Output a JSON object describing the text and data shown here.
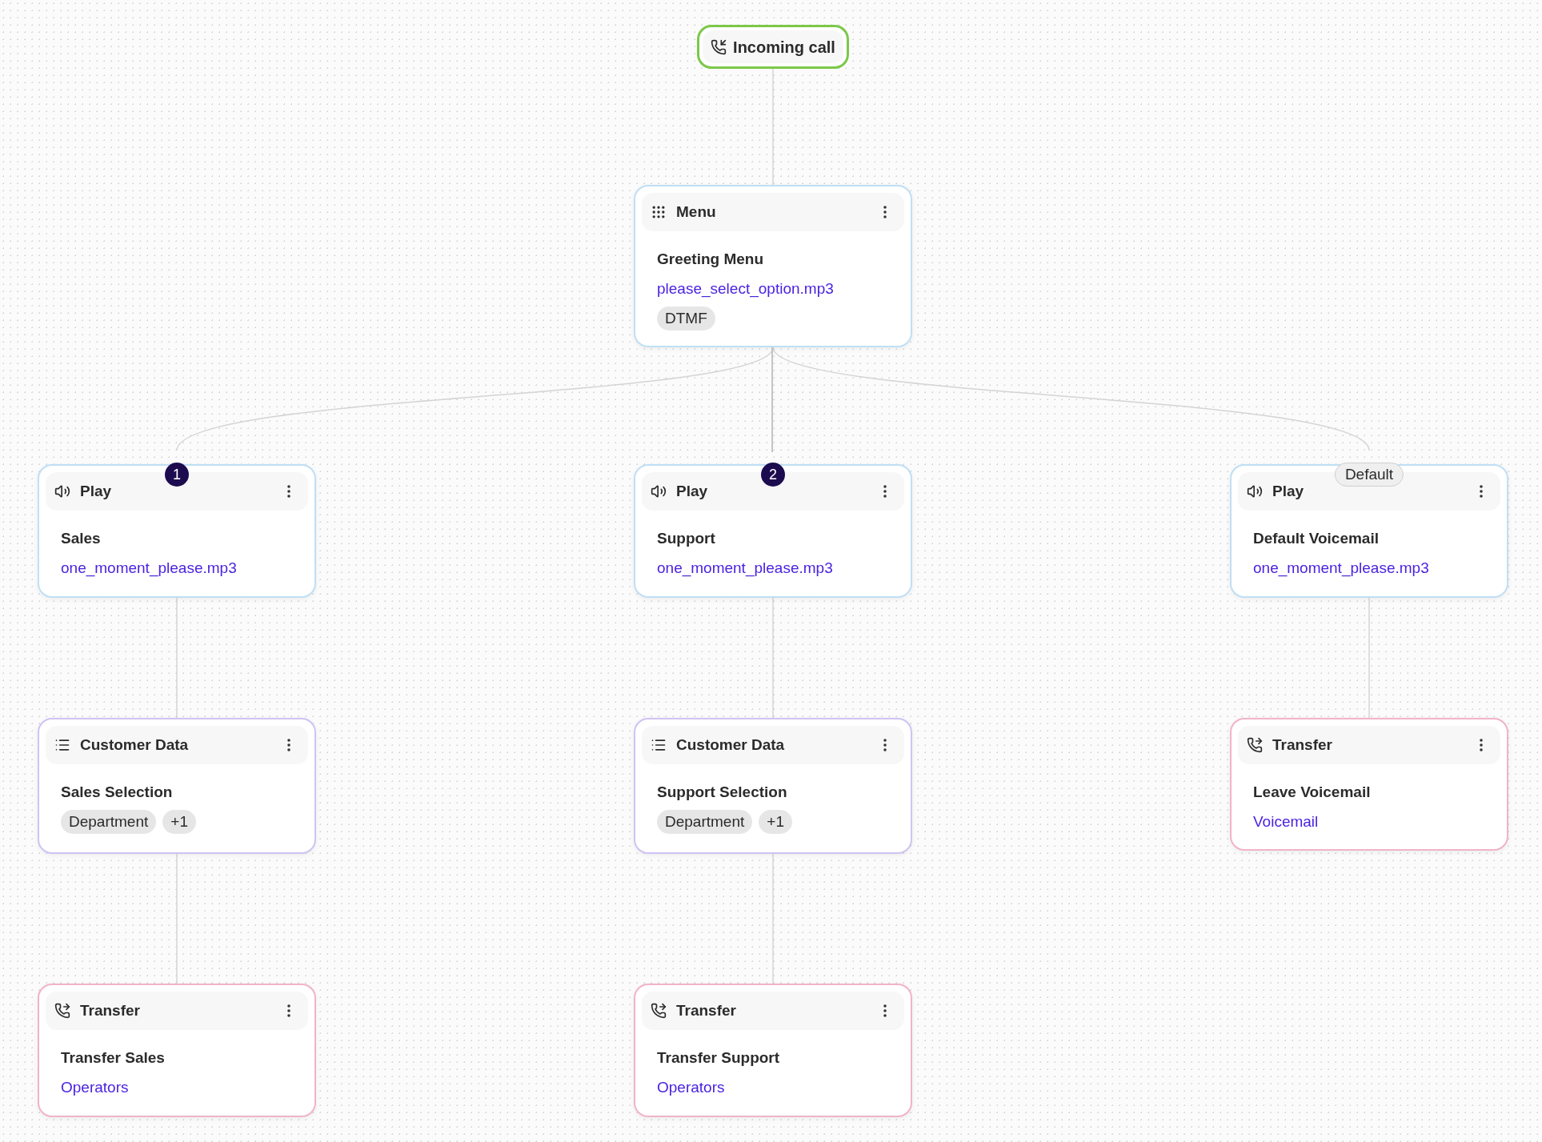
{
  "start": {
    "label": "Incoming call"
  },
  "nodes": [
    {
      "kind": "menu",
      "type_label": "Menu",
      "title": "Greeting Menu",
      "link": "please_select_option.mp3",
      "tags": [
        "DTMF"
      ]
    },
    {
      "kind": "play",
      "type_label": "Play",
      "branch": {
        "kind": "number",
        "text": "1"
      },
      "title": "Sales",
      "link": "one_moment_please.mp3"
    },
    {
      "kind": "play",
      "type_label": "Play",
      "branch": {
        "kind": "number",
        "text": "2"
      },
      "title": "Support",
      "link": "one_moment_please.mp3"
    },
    {
      "kind": "play",
      "type_label": "Play",
      "branch": {
        "kind": "text",
        "text": "Default"
      },
      "title": "Default Voicemail",
      "link": "one_moment_please.mp3"
    },
    {
      "kind": "customer_data",
      "type_label": "Customer Data",
      "title": "Sales Selection",
      "tags": [
        "Department",
        "+1"
      ]
    },
    {
      "kind": "customer_data",
      "type_label": "Customer Data",
      "title": "Support Selection",
      "tags": [
        "Department",
        "+1"
      ]
    },
    {
      "kind": "transfer",
      "type_label": "Transfer",
      "title": "Leave Voicemail",
      "link": "Voicemail"
    },
    {
      "kind": "transfer",
      "type_label": "Transfer",
      "title": "Transfer Sales",
      "link": "Operators"
    },
    {
      "kind": "transfer",
      "type_label": "Transfer",
      "title": "Transfer Support",
      "link": "Operators"
    }
  ]
}
